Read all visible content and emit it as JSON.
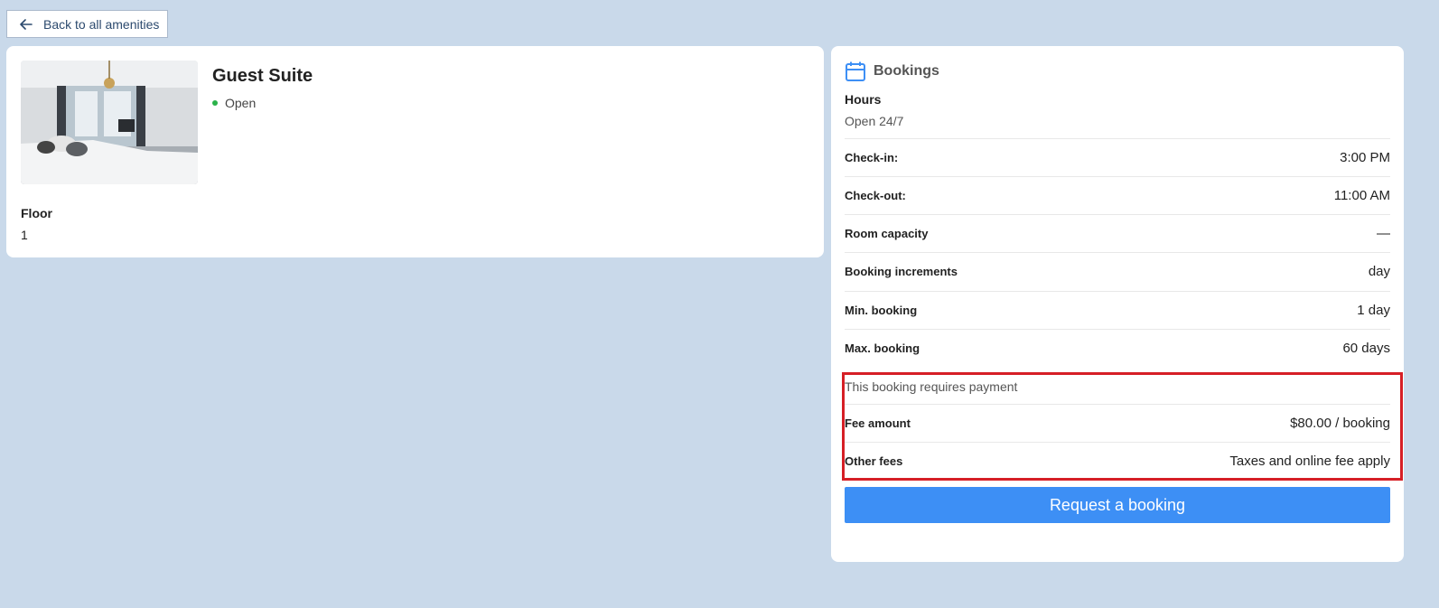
{
  "back": {
    "label": "Back to all amenities"
  },
  "amenity": {
    "title": "Guest Suite",
    "status": "Open",
    "floor_label": "Floor",
    "floor_value": "1"
  },
  "bookings": {
    "heading": "Bookings",
    "hours_label": "Hours",
    "hours_value": "Open 24/7",
    "rows": [
      {
        "key": "Check-in:",
        "value": "3:00 PM"
      },
      {
        "key": "Check-out:",
        "value": "11:00 AM"
      },
      {
        "key": "Room capacity",
        "value": "—"
      },
      {
        "key": "Booking increments",
        "value": "day"
      },
      {
        "key": "Min. booking",
        "value": "1 day"
      },
      {
        "key": "Max. booking",
        "value": "60 days"
      }
    ],
    "payment_note": "This booking requires payment",
    "payment_rows": [
      {
        "key": "Fee amount",
        "value": "$80.00 / booking"
      },
      {
        "key": "Other fees",
        "value": "Taxes and online fee apply"
      }
    ],
    "request_label": "Request a booking"
  },
  "colors": {
    "background": "#c9d9ea",
    "accent": "#3d8ff5",
    "status_open": "#2ab24a",
    "highlight": "#d61f26"
  }
}
